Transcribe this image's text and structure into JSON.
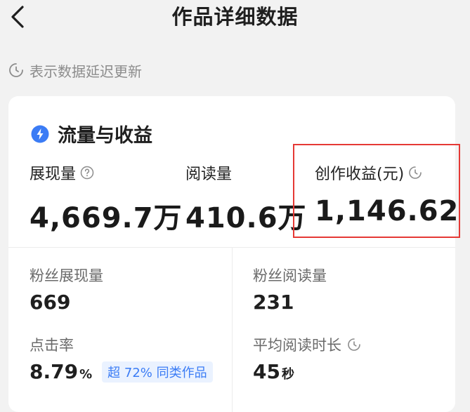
{
  "header": {
    "title": "作品详细数据"
  },
  "notice": {
    "text": "表示数据延迟更新"
  },
  "section": {
    "title": "流量与收益"
  },
  "metrics": [
    {
      "label": "展现量",
      "value": "4,669.7万"
    },
    {
      "label": "阅读量",
      "value": "410.6万"
    },
    {
      "label": "创作收益(元)",
      "value": "1,146.62"
    }
  ],
  "sub_metrics": {
    "fans_impressions": {
      "label": "粉丝展现量",
      "value": "669"
    },
    "fans_reads": {
      "label": "粉丝阅读量",
      "value": "231"
    },
    "ctr": {
      "label": "点击率",
      "value": "8.79",
      "unit": "%",
      "badge": "超 72% 同类作品"
    },
    "avg_read_time": {
      "label": "平均阅读时长",
      "value": "45",
      "unit": "秒"
    }
  },
  "colors": {
    "accent_blue": "#3b7cf5",
    "highlight_red": "#e53935",
    "badge_bg": "#eaf2ff"
  },
  "icons": {
    "back": "chevron-left-icon",
    "clock": "clock-icon",
    "help": "question-circle-icon",
    "section": "lightning-drop-icon"
  }
}
